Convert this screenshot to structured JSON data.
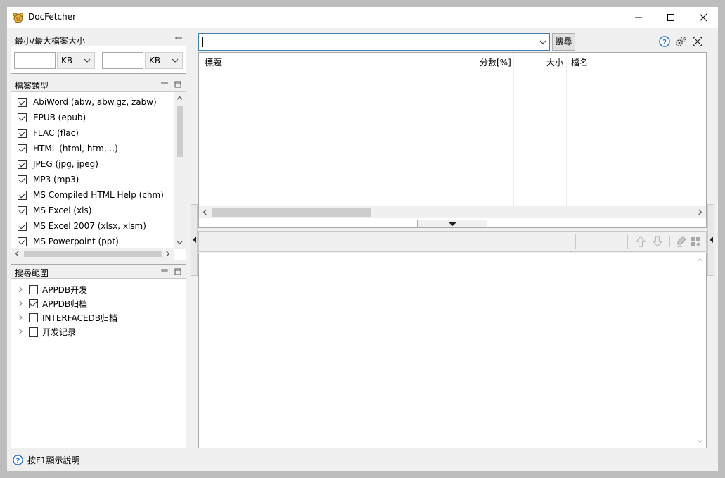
{
  "window": {
    "title": "DocFetcher",
    "controls": [
      "minimize",
      "maximize",
      "close"
    ]
  },
  "size_panel": {
    "title": "最小/最大檔案大小",
    "min_value": "",
    "min_unit": "KB",
    "max_value": "",
    "max_unit": "KB"
  },
  "filetype_panel": {
    "title": "檔案類型",
    "items": [
      {
        "label": "AbiWord (abw, abw.gz, zabw)",
        "checked": true
      },
      {
        "label": "EPUB (epub)",
        "checked": true
      },
      {
        "label": "FLAC (flac)",
        "checked": true
      },
      {
        "label": "HTML (html, htm, ..)",
        "checked": true
      },
      {
        "label": "JPEG (jpg, jpeg)",
        "checked": true
      },
      {
        "label": "MP3 (mp3)",
        "checked": true
      },
      {
        "label": "MS Compiled HTML Help (chm)",
        "checked": true
      },
      {
        "label": "MS Excel (xls)",
        "checked": true
      },
      {
        "label": "MS Excel 2007 (xlsx, xlsm)",
        "checked": true
      },
      {
        "label": "MS Powerpoint (ppt)",
        "checked": true
      }
    ]
  },
  "scope_panel": {
    "title": "搜尋範圍",
    "items": [
      {
        "label": "APPDB开发",
        "checked": false
      },
      {
        "label": "APPDB归档",
        "checked": true
      },
      {
        "label": "INTERFACEDB归档",
        "checked": false
      },
      {
        "label": "开发记录",
        "checked": false
      }
    ]
  },
  "search": {
    "query": "",
    "button_label": "搜尋"
  },
  "results": {
    "columns": [
      "標題",
      "分數[%]",
      "大小",
      "檔名"
    ]
  },
  "status_bar": {
    "help_text": "按F1顯示說明"
  },
  "colors": {
    "accent_border": "#3c7fb1",
    "help_icon": "#1e6fc6",
    "panel_border": "#a8a8a8"
  }
}
